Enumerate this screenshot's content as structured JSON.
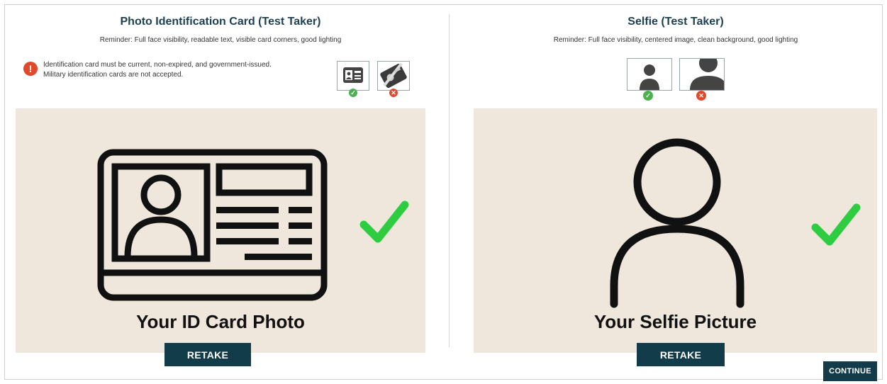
{
  "id_section": {
    "title": "Photo Identification Card (Test Taker)",
    "reminder": "Reminder: Full face visibility, readable text, visible card corners, good lighting",
    "notice_icon": "!",
    "notice_line1": "Identification card must be current, non-expired, and government-issued.",
    "notice_line2": "Military identification cards are not accepted.",
    "caption": "Your ID Card Photo",
    "retake_label": "RETAKE"
  },
  "selfie_section": {
    "title": "Selfie (Test Taker)",
    "reminder": "Reminder: Full face visibility, centered image, clean background, good lighting",
    "caption": "Your Selfie Picture",
    "retake_label": "RETAKE"
  },
  "footer": {
    "continue_label": "CONTINUE"
  },
  "icons": {
    "ok": "✓",
    "bad": "✕"
  },
  "colors": {
    "panel": "#efe7dc",
    "button": "#123c4a",
    "title": "#1d3f4f",
    "check": "#2ecc40",
    "ok_badge": "#4caf50",
    "bad_badge": "#e04a2a"
  }
}
